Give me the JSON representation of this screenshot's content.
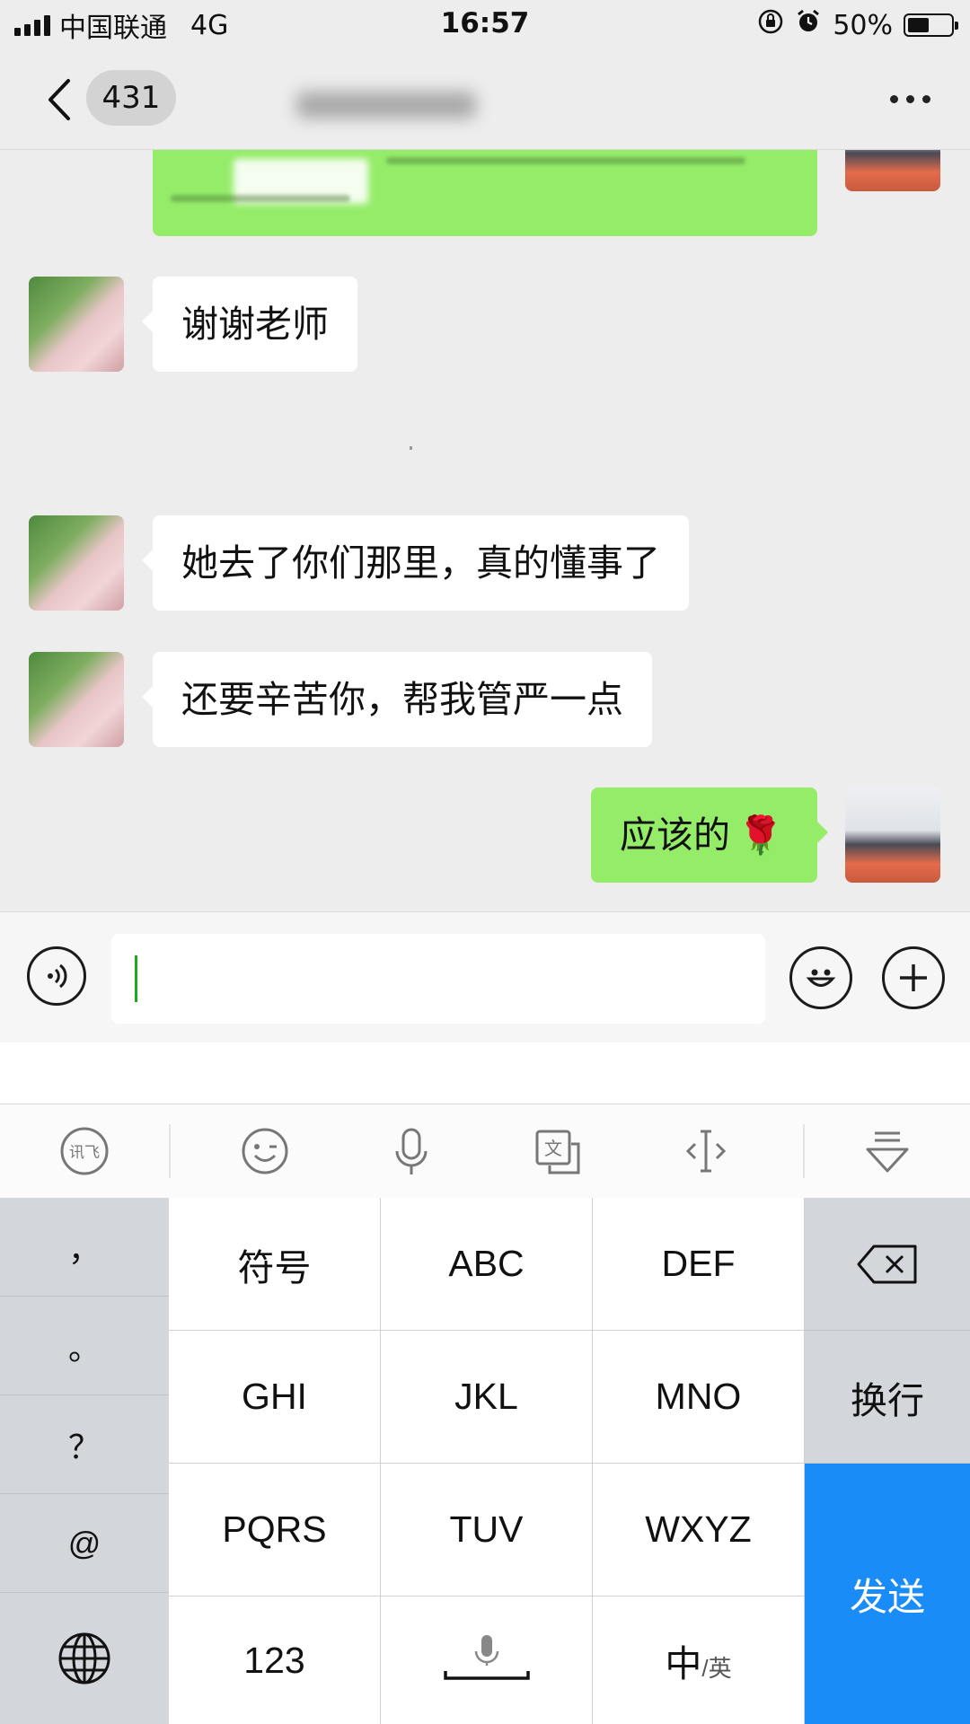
{
  "status_bar": {
    "carrier": "中国联通",
    "network": "4G",
    "time": "16:57",
    "battery_text": "50%",
    "battery_level": 0.5
  },
  "nav": {
    "unread_count": "431"
  },
  "messages": [
    {
      "side": "left",
      "text": "谢谢老师"
    },
    {
      "side": "left",
      "text": "她去了你们那里，真的懂事了"
    },
    {
      "side": "left",
      "text": "还要辛苦你，帮我管严一点"
    },
    {
      "side": "right",
      "text": "应该的",
      "emoji": "🌹"
    }
  ],
  "input": {
    "value": ""
  },
  "keyboard": {
    "left_column": [
      "，",
      "。",
      "？",
      "@"
    ],
    "main_keys": [
      [
        "符号",
        "ABC",
        "DEF"
      ],
      [
        "GHI",
        "JKL",
        "MNO"
      ],
      [
        "PQRS",
        "TUV",
        "WXYZ"
      ]
    ],
    "bottom_keys": {
      "numbers": "123",
      "lang_main": "中",
      "lang_sub": "/英"
    },
    "right_column": {
      "newline": "换行",
      "send": "发送"
    },
    "toolbar_icons": [
      "ifly-logo-icon",
      "emoji-icon",
      "microphone-icon",
      "translate-icon",
      "cursor-icon",
      "hide-keyboard-icon"
    ]
  },
  "colors": {
    "chat_background": "#ededed",
    "bubble_sent": "#95ec69",
    "bubble_received": "#ffffff",
    "send_key": "#1a8cf7"
  }
}
